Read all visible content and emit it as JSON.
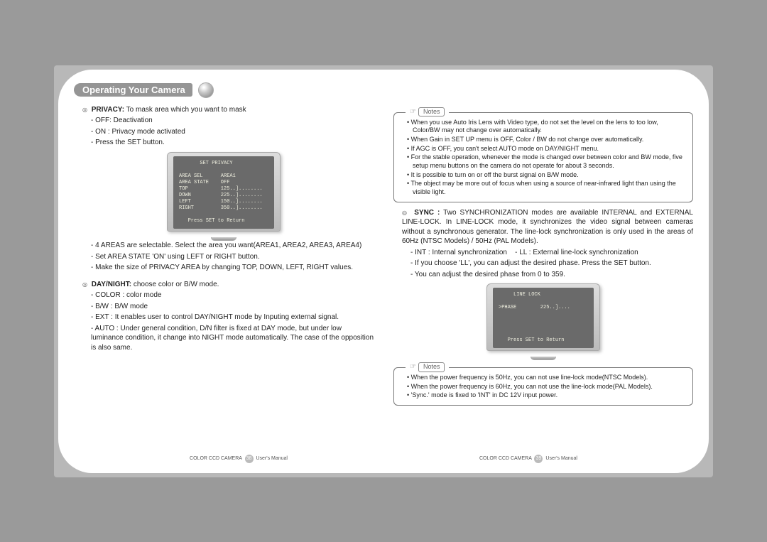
{
  "header": {
    "title": "Operating Your Camera"
  },
  "left": {
    "privacy": {
      "heading_label": "PRIVACY:",
      "heading_rest": " To mask area which you want to mask",
      "l1": "- OFF: Deactivation",
      "l2": "- ON : Privacy mode activated",
      "l3": "- Press the SET button.",
      "screen": "       SET PRIVACY\n\nAREA SEL      AREA1\nAREA STATE    OFF\nTOP           125..]........\nDOWN          225..]........\nLEFT          150..]........\nRIGHT         350..]........\n\n   Press SET to Return",
      "l4": "- 4 AREAS are selectable. Select the area you want(AREA1, AREA2, AREA3, AREA4)",
      "l5": "- Set AREA STATE 'ON' using LEFT or RIGHT button.",
      "l6": "- Make the size of PRIVACY AREA by changing TOP, DOWN, LEFT, RIGHT values."
    },
    "daynight": {
      "heading_label": "DAY/NIGHT:",
      "heading_rest": " choose color or B/W mode.",
      "l1": "- COLOR : color mode",
      "l2": "- B/W : B/W mode",
      "l3": "- EXT : It enables user to control DAY/NIGHT mode by Inputing external signal.",
      "l4": "- AUTO : Under general condition, D/N filter is fixed at DAY mode, but under low luminance condition, it change into NIGHT mode automatically. The case of the opposition is also same."
    }
  },
  "right": {
    "notes1_label": "Notes",
    "notes1": {
      "n1": "When you use Auto Iris Lens with Video type, do not set the level on the lens to too low, Color/BW may not change over automatically.",
      "n2": "When Gain in SET UP menu is OFF, Color / BW do not change over automatically.",
      "n3": "If AGC is OFF, you can't select AUTO mode on DAY/NIGHT menu.",
      "n4": "For the stable operation, whenever the mode is changed over between color and BW mode, five setup menu buttons on the camera do not operate for about 3 seconds.",
      "n5": "It is possible to turn on or off the burst signal on B/W mode.",
      "n6": "The object may be more out of focus when using a source of near-infrared light than using the visible light."
    },
    "sync": {
      "heading_label": "SYNC :",
      "heading_rest": " Two SYNCHRONIZATION modes are available INTERNAL and EXTERNAL LINE-LOCK. In LINE-LOCK mode, it synchronizes the video signal between cameras without a synchronous generator. The line-lock synchronization is only used in the areas of 60Hz (NTSC Models) / 50Hz (PAL Models).",
      "l1a": "- INT : Internal synchronization",
      "l1b": "- LL : External line-lock synchronization",
      "l2": "- If you choose 'LL', you can adjust the desired phase.  Press the SET button.",
      "l3": "- You can adjust the desired phase from 0 to 359.",
      "screen": "     LINE LOCK\n\n>PHASE        225..]....\n\n\n\n\n   Press SET to Return"
    },
    "notes2_label": "Notes",
    "notes2": {
      "n1": "When the power frequency is 50Hz, you can not use line-lock mode(NTSC Models).",
      "n2": "When the power frequency is 60Hz, you can not use the line-lock mode(PAL Models).",
      "n3": "'Sync.' mode is fixed to 'INT' in DC 12V input power."
    }
  },
  "footer": {
    "left_a": "COLOR CCD CAMERA",
    "left_pg": "38",
    "left_b": "User's Manual",
    "right_a": "COLOR CCD CAMERA",
    "right_pg": "39",
    "right_b": "User's Manual"
  }
}
